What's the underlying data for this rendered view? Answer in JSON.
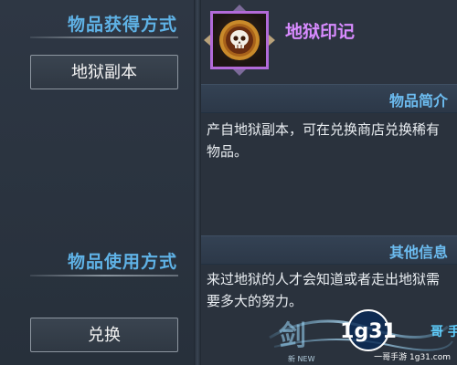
{
  "left": {
    "obtain_title": "物品获得方式",
    "obtain_button": "地狱副本",
    "use_title": "物品使用方式",
    "use_button": "兑换"
  },
  "item": {
    "name": "地狱印记",
    "icon": "skull-icon",
    "name_color": "#d88bff",
    "frame_color": "#b26ad8"
  },
  "intro": {
    "title": "物品简介",
    "text": "产自地狱副本，可在兑换商店兑换稀有物品。"
  },
  "other": {
    "title": "其他信息",
    "text": "来过地狱的人才会知道或者走出地狱需要多大的努力。"
  },
  "watermark": {
    "brand": "1g31",
    "subtitle": "一哥手游 1g31.com",
    "side_text": "哥 手游",
    "logo_text": "新 NEW"
  },
  "colors": {
    "accent_blue": "#5fb2e6",
    "panel": "#2b3440"
  }
}
